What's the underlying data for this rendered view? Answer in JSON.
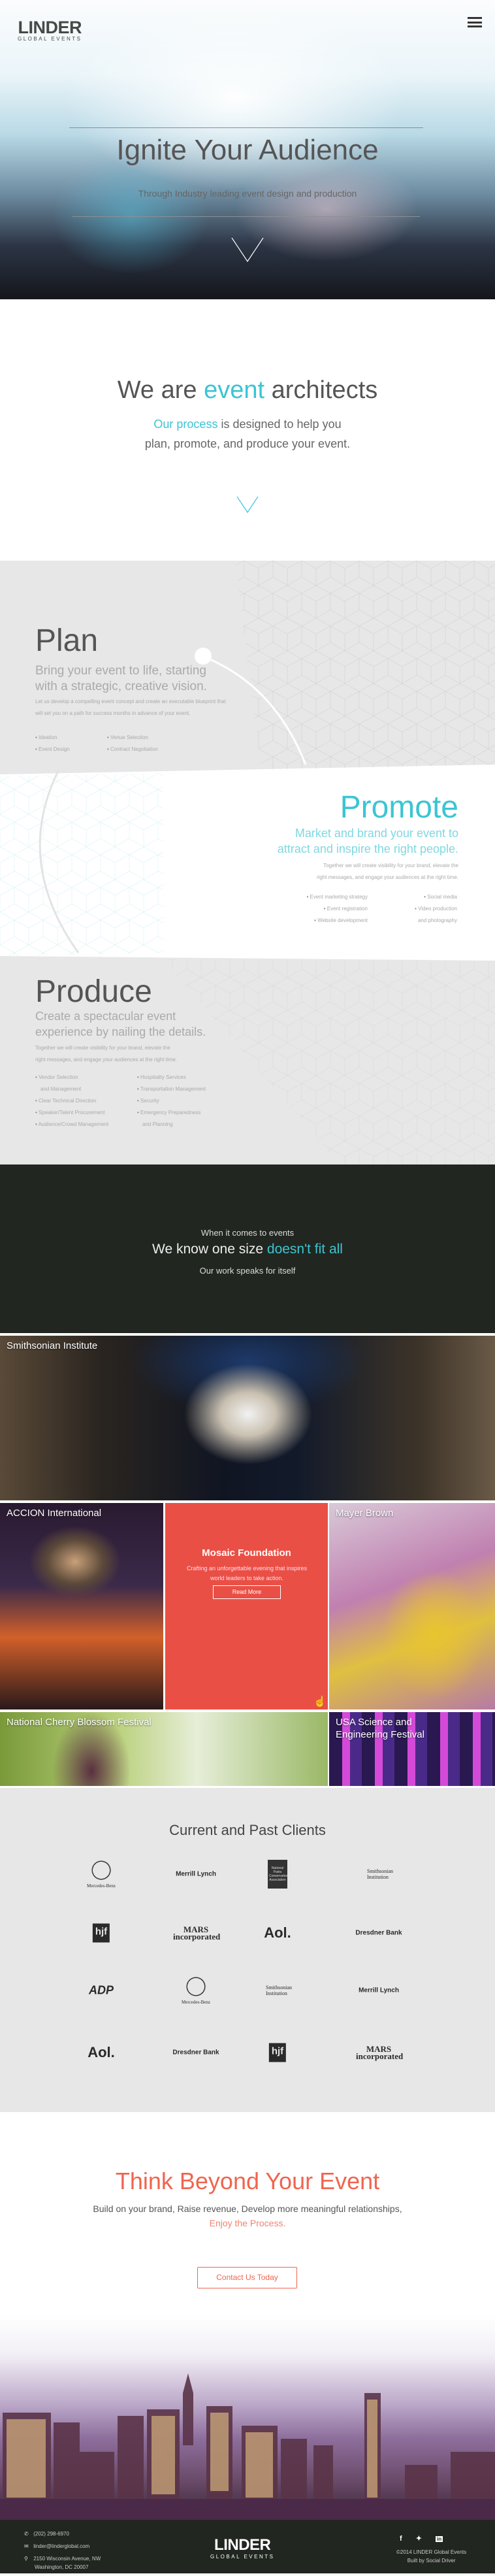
{
  "brand": {
    "name": "LINDER",
    "tagline": "GLOBAL EVENTS"
  },
  "hero": {
    "title": "Ignite Your Audience",
    "subtitle": "Through Industry leading event design and production"
  },
  "intro": {
    "title_pre": "We are ",
    "title_accent": "event",
    "title_post": " architects",
    "line1_accent": "Our process",
    "line1_rest": " is designed to help you",
    "line2": "plan, promote, and produce your event."
  },
  "plan": {
    "title": "Plan",
    "subtitle": "Bring your event to life, starting with a strategic, creative vision.",
    "body": "Let us develop a compelling event concept and create an executable blueprint that will set you on a path for success months in advance of your event.",
    "col1": [
      "Ideation",
      "Event Design"
    ],
    "col2": [
      "Venue Selection",
      "Contract Negotiation"
    ]
  },
  "promote": {
    "title": "Promote",
    "subtitle_line1": "Market and brand your event to",
    "subtitle_line2": "attract and inspire the right people.",
    "body_line1": "Together we will create visibility for your brand, elevate the",
    "body_line2": "right messages, and engage your audiences at the right time.",
    "col1": [
      "Event marketing strategy",
      "Event registration",
      "Website development"
    ],
    "col2": [
      "Social media",
      "Video production",
      "and photography"
    ]
  },
  "produce": {
    "title": "Produce",
    "subtitle_line1": "Create a spectacular event",
    "subtitle_line2": "experience by nailing the details.",
    "body_line1": "Together we will create visibility for your brand, elevate the",
    "body_line2": "right messages, and engage your audiences at the right time.",
    "col1": [
      "Vendor Selection",
      "and Management",
      "Clear Technical Direction",
      "Speaker/Talent Procurement",
      "Audience/Crowd Management"
    ],
    "col2": [
      "Hospitality Services",
      "Transportation Management",
      "Security",
      "Emergency Preparedness",
      "and Planning"
    ]
  },
  "statement": {
    "line1": "When it comes to events",
    "line2_pre": "We know one size ",
    "line2_accent": "doesn't fit all",
    "line3": "Our work speaks for itself"
  },
  "portfolio": {
    "items": [
      {
        "label": "Smithsonian Institute"
      },
      {
        "label": "ACCION International"
      },
      {
        "label": "Mosaic Foundation",
        "description": "Crafting an unforgettable evening that inspires world leaders to take action.",
        "button": "Read More"
      },
      {
        "label": "Mayer Brown"
      },
      {
        "label": "National Cherry Blossom Festival"
      },
      {
        "label": "USA Science and Engineering Festival"
      }
    ]
  },
  "clients": {
    "title": "Current and Past Clients",
    "logos": [
      "Mercedes-Benz",
      "Merrill Lynch",
      "National Parks Conservation Association",
      "Smithsonian Institution",
      "hjf",
      "MARS incorporated",
      "Aol.",
      "Dresdner Bank",
      "ADP",
      "Mercedes-Benz",
      "Smithsonian Institution",
      "Merrill Lynch",
      "Aol.",
      "Dresdner Bank",
      "hjf",
      "MARS incorporated"
    ]
  },
  "cta": {
    "title": "Think Beyond Your Event",
    "line1": "Build on your brand, Raise revenue, Develop more meaningful relationships,",
    "line2": "Enjoy the Process.",
    "button": "Contact Us Today"
  },
  "footer": {
    "phone": "(202) 298-6970",
    "email": "linder@linderglobal.com",
    "address_line1": "2150 Wisconsin Avenue, NW",
    "address_line2": "Washington, DC 20007",
    "copyright": "©2014 LINDER Global Events",
    "credit": "Built by Social Driver",
    "social": [
      "facebook",
      "twitter",
      "linkedin"
    ]
  },
  "colors": {
    "teal": "#3bc5d3",
    "coral": "#f0654f",
    "dark": "#212620",
    "gray": "#e7e7e7"
  }
}
